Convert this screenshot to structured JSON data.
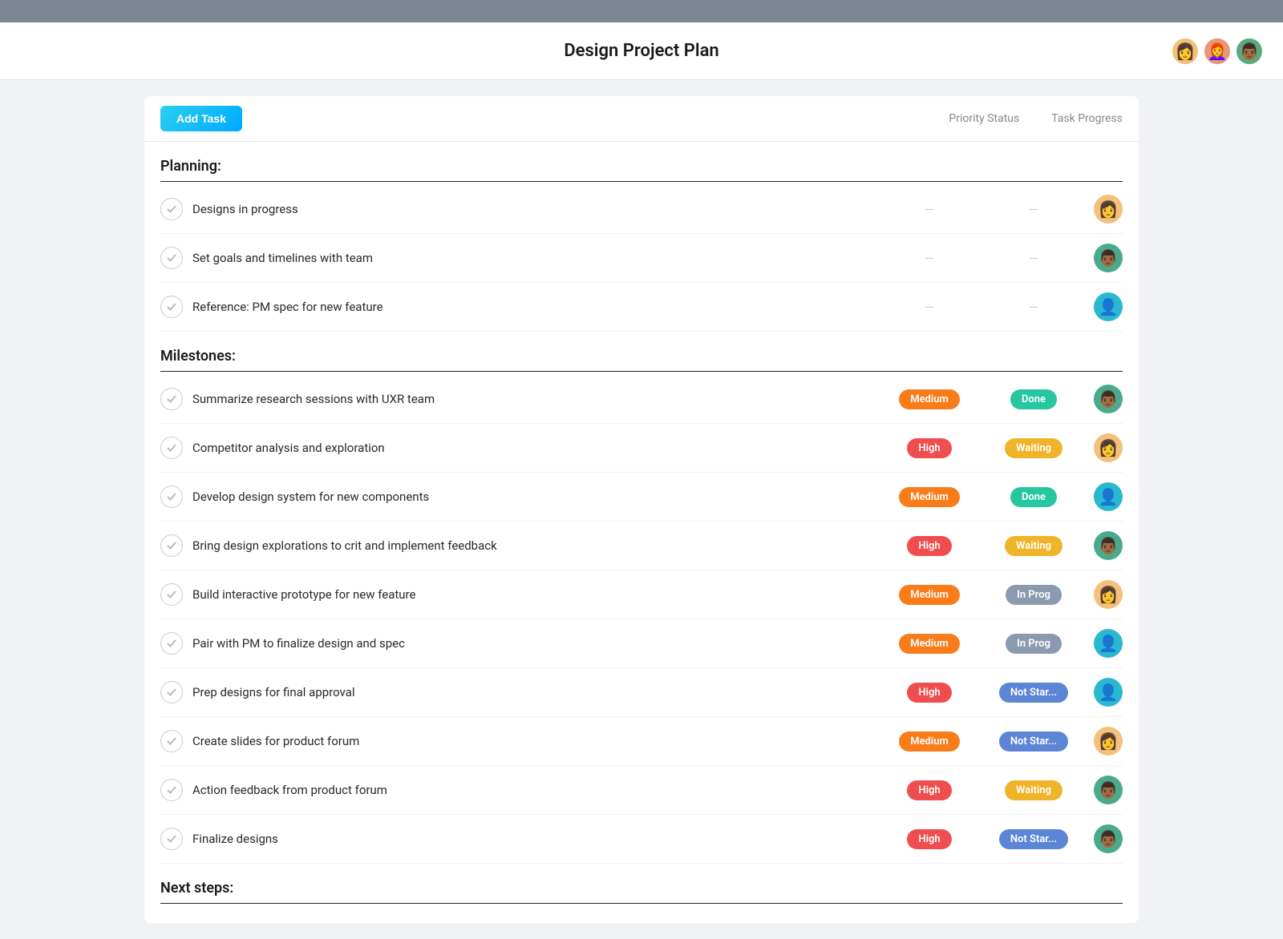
{
  "topBar": {},
  "header": {
    "title": "Design Project Plan",
    "avatars": [
      {
        "id": "avatar-1",
        "emoji": "👩",
        "bg": "#f4c07a"
      },
      {
        "id": "avatar-2",
        "emoji": "👩‍🦰",
        "bg": "#e9967a"
      },
      {
        "id": "avatar-3",
        "emoji": "👨🏾",
        "bg": "#4aaa8c"
      }
    ]
  },
  "toolbar": {
    "addTask": "Add Task",
    "priorityLabel": "Priority Status",
    "progressLabel": "Task Progress"
  },
  "sections": [
    {
      "id": "planning",
      "label": "Planning:",
      "tasks": [
        {
          "id": "t1",
          "name": "Designs in progress",
          "priority": null,
          "status": null,
          "avatarEmoji": "👩",
          "avatarBg": "#f4c07a"
        },
        {
          "id": "t2",
          "name": "Set goals and timelines with team",
          "priority": null,
          "status": null,
          "avatarEmoji": "👨🏾",
          "avatarBg": "#4aaa8c"
        },
        {
          "id": "t3",
          "name": "Reference: PM spec for new feature",
          "priority": null,
          "status": null,
          "avatarEmoji": "👤",
          "avatarBg": "#29b8d0"
        }
      ]
    },
    {
      "id": "milestones",
      "label": "Milestones:",
      "tasks": [
        {
          "id": "t4",
          "name": "Summarize research sessions with UXR team",
          "priority": "Medium",
          "priorityClass": "badge-medium",
          "status": "Done",
          "statusClass": "badge-done",
          "avatarEmoji": "👨🏾",
          "avatarBg": "#4aaa8c"
        },
        {
          "id": "t5",
          "name": "Competitor analysis and exploration",
          "priority": "High",
          "priorityClass": "badge-high",
          "status": "Waiting",
          "statusClass": "badge-waiting",
          "avatarEmoji": "👩",
          "avatarBg": "#f4c07a"
        },
        {
          "id": "t6",
          "name": "Develop design system for new components",
          "priority": "Medium",
          "priorityClass": "badge-medium",
          "status": "Done",
          "statusClass": "badge-done",
          "avatarEmoji": "👤",
          "avatarBg": "#29b8d0"
        },
        {
          "id": "t7",
          "name": "Bring design explorations to crit and implement feedback",
          "priority": "High",
          "priorityClass": "badge-high",
          "status": "Waiting",
          "statusClass": "badge-waiting",
          "avatarEmoji": "👨🏾",
          "avatarBg": "#4aaa8c"
        },
        {
          "id": "t8",
          "name": "Build interactive prototype for new feature",
          "priority": "Medium",
          "priorityClass": "badge-medium",
          "status": "In Prog",
          "statusClass": "badge-inprog",
          "avatarEmoji": "👩",
          "avatarBg": "#f4c07a"
        },
        {
          "id": "t9",
          "name": "Pair with PM to finalize design and spec",
          "priority": "Medium",
          "priorityClass": "badge-medium",
          "status": "In Prog",
          "statusClass": "badge-inprog",
          "avatarEmoji": "👤",
          "avatarBg": "#29b8d0"
        },
        {
          "id": "t10",
          "name": "Prep designs for final approval",
          "priority": "High",
          "priorityClass": "badge-high",
          "status": "Not Star...",
          "statusClass": "badge-notstar",
          "avatarEmoji": "👤",
          "avatarBg": "#29b8d0"
        },
        {
          "id": "t11",
          "name": "Create slides for product forum",
          "priority": "Medium",
          "priorityClass": "badge-medium",
          "status": "Not Star...",
          "statusClass": "badge-notstar",
          "avatarEmoji": "👩",
          "avatarBg": "#f4c07a"
        },
        {
          "id": "t12",
          "name": "Action feedback from product forum",
          "priority": "High",
          "priorityClass": "badge-high",
          "status": "Waiting",
          "statusClass": "badge-waiting",
          "avatarEmoji": "👨🏾",
          "avatarBg": "#4aaa8c"
        },
        {
          "id": "t13",
          "name": "Finalize designs",
          "priority": "High",
          "priorityClass": "badge-high",
          "status": "Not Star...",
          "statusClass": "badge-notstar",
          "avatarEmoji": "👨🏾",
          "avatarBg": "#4aaa8c"
        }
      ]
    },
    {
      "id": "nextsteps",
      "label": "Next steps:",
      "tasks": []
    }
  ]
}
